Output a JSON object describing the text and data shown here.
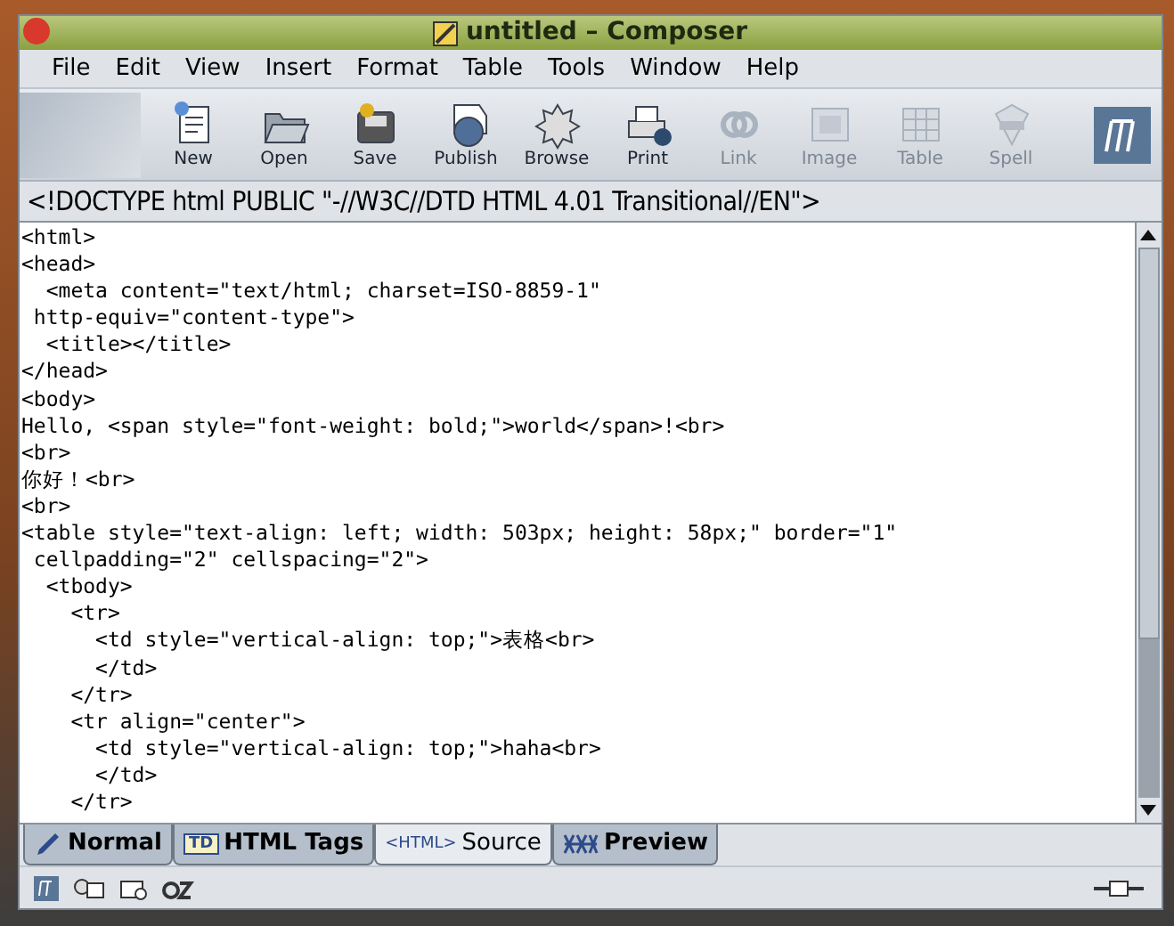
{
  "window": {
    "title": "untitled – Composer"
  },
  "menu": [
    "File",
    "Edit",
    "View",
    "Insert",
    "Format",
    "Table",
    "Tools",
    "Window",
    "Help"
  ],
  "toolbar": [
    {
      "label": "New",
      "kind": "new",
      "disabled": false
    },
    {
      "label": "Open",
      "kind": "open",
      "disabled": false
    },
    {
      "label": "Save",
      "kind": "save",
      "disabled": false
    },
    {
      "label": "Publish",
      "kind": "publish",
      "disabled": false
    },
    {
      "label": "Browse",
      "kind": "browse",
      "disabled": false
    },
    {
      "label": "Print",
      "kind": "print",
      "disabled": false
    },
    {
      "label": "Link",
      "kind": "link",
      "disabled": true
    },
    {
      "label": "Image",
      "kind": "image",
      "disabled": true
    },
    {
      "label": "Table",
      "kind": "table",
      "disabled": true
    },
    {
      "label": "Spell",
      "kind": "spell",
      "disabled": true
    }
  ],
  "doctype": "<!DOCTYPE html PUBLIC \"-//W3C//DTD HTML 4.01 Transitional//EN\">",
  "source_lines": [
    "<html>",
    "<head>",
    "  <meta content=\"text/html; charset=ISO-8859-1\"",
    " http-equiv=\"content-type\">",
    "  <title></title>",
    "</head>",
    "<body>",
    "Hello, <span style=\"font-weight: bold;\">world</span>!<br>",
    "<br>",
    "你好！<br>",
    "<br>",
    "<table style=\"text-align: left; width: 503px; height: 58px;\" border=\"1\"",
    " cellpadding=\"2\" cellspacing=\"2\">",
    "  <tbody>",
    "    <tr>",
    "      <td style=\"vertical-align: top;\">表格<br>",
    "      </td>",
    "    </tr>",
    "    <tr align=\"center\">",
    "      <td style=\"vertical-align: top;\">haha<br>",
    "      </td>",
    "    </tr>"
  ],
  "mode_tabs": [
    {
      "label": "Normal",
      "kind": "normal",
      "selected": false
    },
    {
      "label": "HTML Tags",
      "kind": "tags",
      "badge": "TD",
      "selected": false
    },
    {
      "label": "Source",
      "kind": "source",
      "badge": "<HTML>",
      "selected": true
    },
    {
      "label": "Preview",
      "kind": "preview",
      "selected": false
    }
  ]
}
